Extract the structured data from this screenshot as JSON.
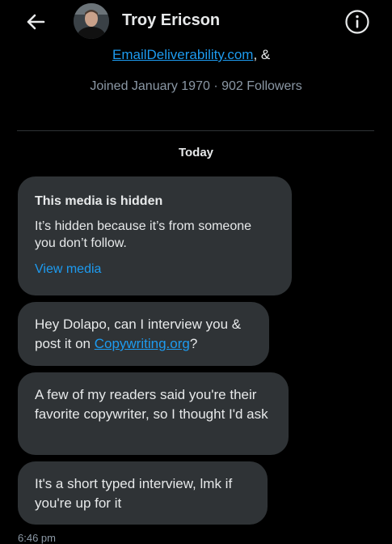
{
  "header": {
    "title": "Troy Ericson",
    "back_icon": "arrow-left-icon",
    "info_icon": "info-icon"
  },
  "profile": {
    "bio_link": "EmailDeliverability.com",
    "bio_suffix": ", &",
    "joined": "Joined January 1970 · 902 Followers"
  },
  "conversation": {
    "day_label": "Today",
    "hidden_media": {
      "title": "This media is hidden",
      "body": "It’s hidden because it’s from someone you don’t follow.",
      "link": "View media"
    },
    "messages": [
      {
        "before": "Hey Dolapo, can I interview you & post it on ",
        "link": "Copywriting.org",
        "after": "?"
      },
      {
        "text": "A few of my readers said you're their favorite copywriter, so I thought I'd ask"
      },
      {
        "text": "It's a short typed interview, lmk if you're up for it"
      }
    ],
    "timestamp": "6:46 pm"
  },
  "colors": {
    "background": "#000000",
    "bubble": "#2f3336",
    "link": "#1d9bf0",
    "muted": "#8b98a5"
  }
}
